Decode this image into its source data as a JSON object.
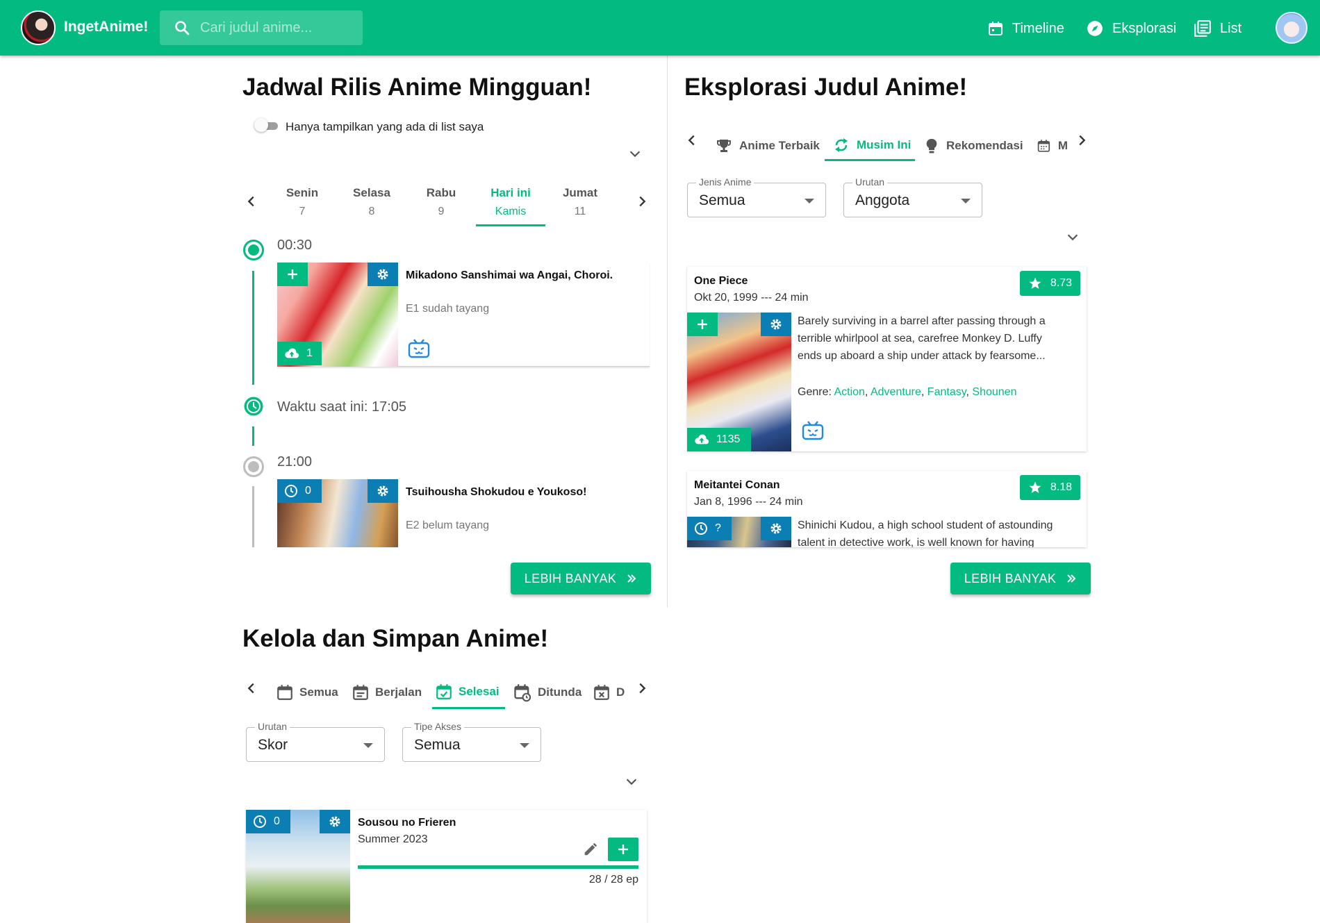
{
  "appbar": {
    "brand": "IngetAnime!",
    "search_placeholder": "Cari judul anime...",
    "nav": [
      {
        "label": "Timeline",
        "icon": "calendar-icon"
      },
      {
        "label": "Eksplorasi",
        "icon": "compass-icon"
      },
      {
        "label": "List",
        "icon": "library-list-icon"
      }
    ]
  },
  "schedule": {
    "title": "Jadwal Rilis Anime Mingguan!",
    "toggle_label": "Hanya tampilkan yang ada di list saya",
    "days": [
      {
        "name": "Senin",
        "sub": "7"
      },
      {
        "name": "Selasa",
        "sub": "8"
      },
      {
        "name": "Rabu",
        "sub": "9"
      },
      {
        "name": "Hari ini",
        "sub": "Kamis"
      },
      {
        "name": "Jumat",
        "sub": "11"
      }
    ],
    "active_day": 3,
    "slots": [
      {
        "time": "00:30",
        "title": "Mikadono Sanshimai wa Angai, Choroi.",
        "status": "E1 sudah tayang",
        "badge": "1",
        "badge_icon": "cloud-upload-icon"
      },
      {
        "time": "21:00",
        "title": "Tsuihousha Shokudou e Youkoso!",
        "status": "E2 belum tayang",
        "badge": "0",
        "badge_icon": "clock-icon"
      }
    ],
    "now_label": "Waktu saat ini: 17:05",
    "more_label": "LEBIH BANYAK"
  },
  "explore": {
    "title": "Eksplorasi Judul Anime!",
    "tabs": [
      "Anime Terbaik",
      "Musim Ini",
      "Rekomendasi",
      "M"
    ],
    "active_tab": 1,
    "filters": [
      {
        "label": "Jenis Anime",
        "value": "Semua"
      },
      {
        "label": "Urutan",
        "value": "Anggota"
      }
    ],
    "cards": [
      {
        "title": "One Piece",
        "meta": "Okt 20, 1999 --- 24 min",
        "score": "8.73",
        "badge": "1135",
        "synopsis": "Barely surviving in a barrel after passing through a terrible whirlpool at sea, carefree Monkey D. Luffy ends up aboard a ship under attack by fearsome...",
        "genre_label": "Genre:",
        "genres": [
          "Action",
          "Adventure",
          "Fantasy",
          "Shounen"
        ]
      },
      {
        "title": "Meitantei Conan",
        "meta": "Jan 8, 1996 --- 24 min",
        "score": "8.18",
        "badge": "?",
        "synopsis": "Shinichi Kudou, a high school student of astounding talent in detective work, is well known for having"
      }
    ],
    "more_label": "LEBIH BANYAK"
  },
  "manage": {
    "title": "Kelola dan Simpan Anime!",
    "tabs": [
      "Semua",
      "Berjalan",
      "Selesai",
      "Ditunda",
      "D"
    ],
    "active_tab": 2,
    "filters": [
      {
        "label": "Urutan",
        "value": "Skor"
      },
      {
        "label": "Tipe Akses",
        "value": "Semua"
      }
    ],
    "item": {
      "title": "Sousou no Frieren",
      "season": "Summer 2023",
      "badge": "0",
      "progress": "28 / 28 ep",
      "progress_fraction": 1.0
    }
  },
  "colors": {
    "accent": "#03bb81",
    "blue": "#0b7fb3"
  }
}
